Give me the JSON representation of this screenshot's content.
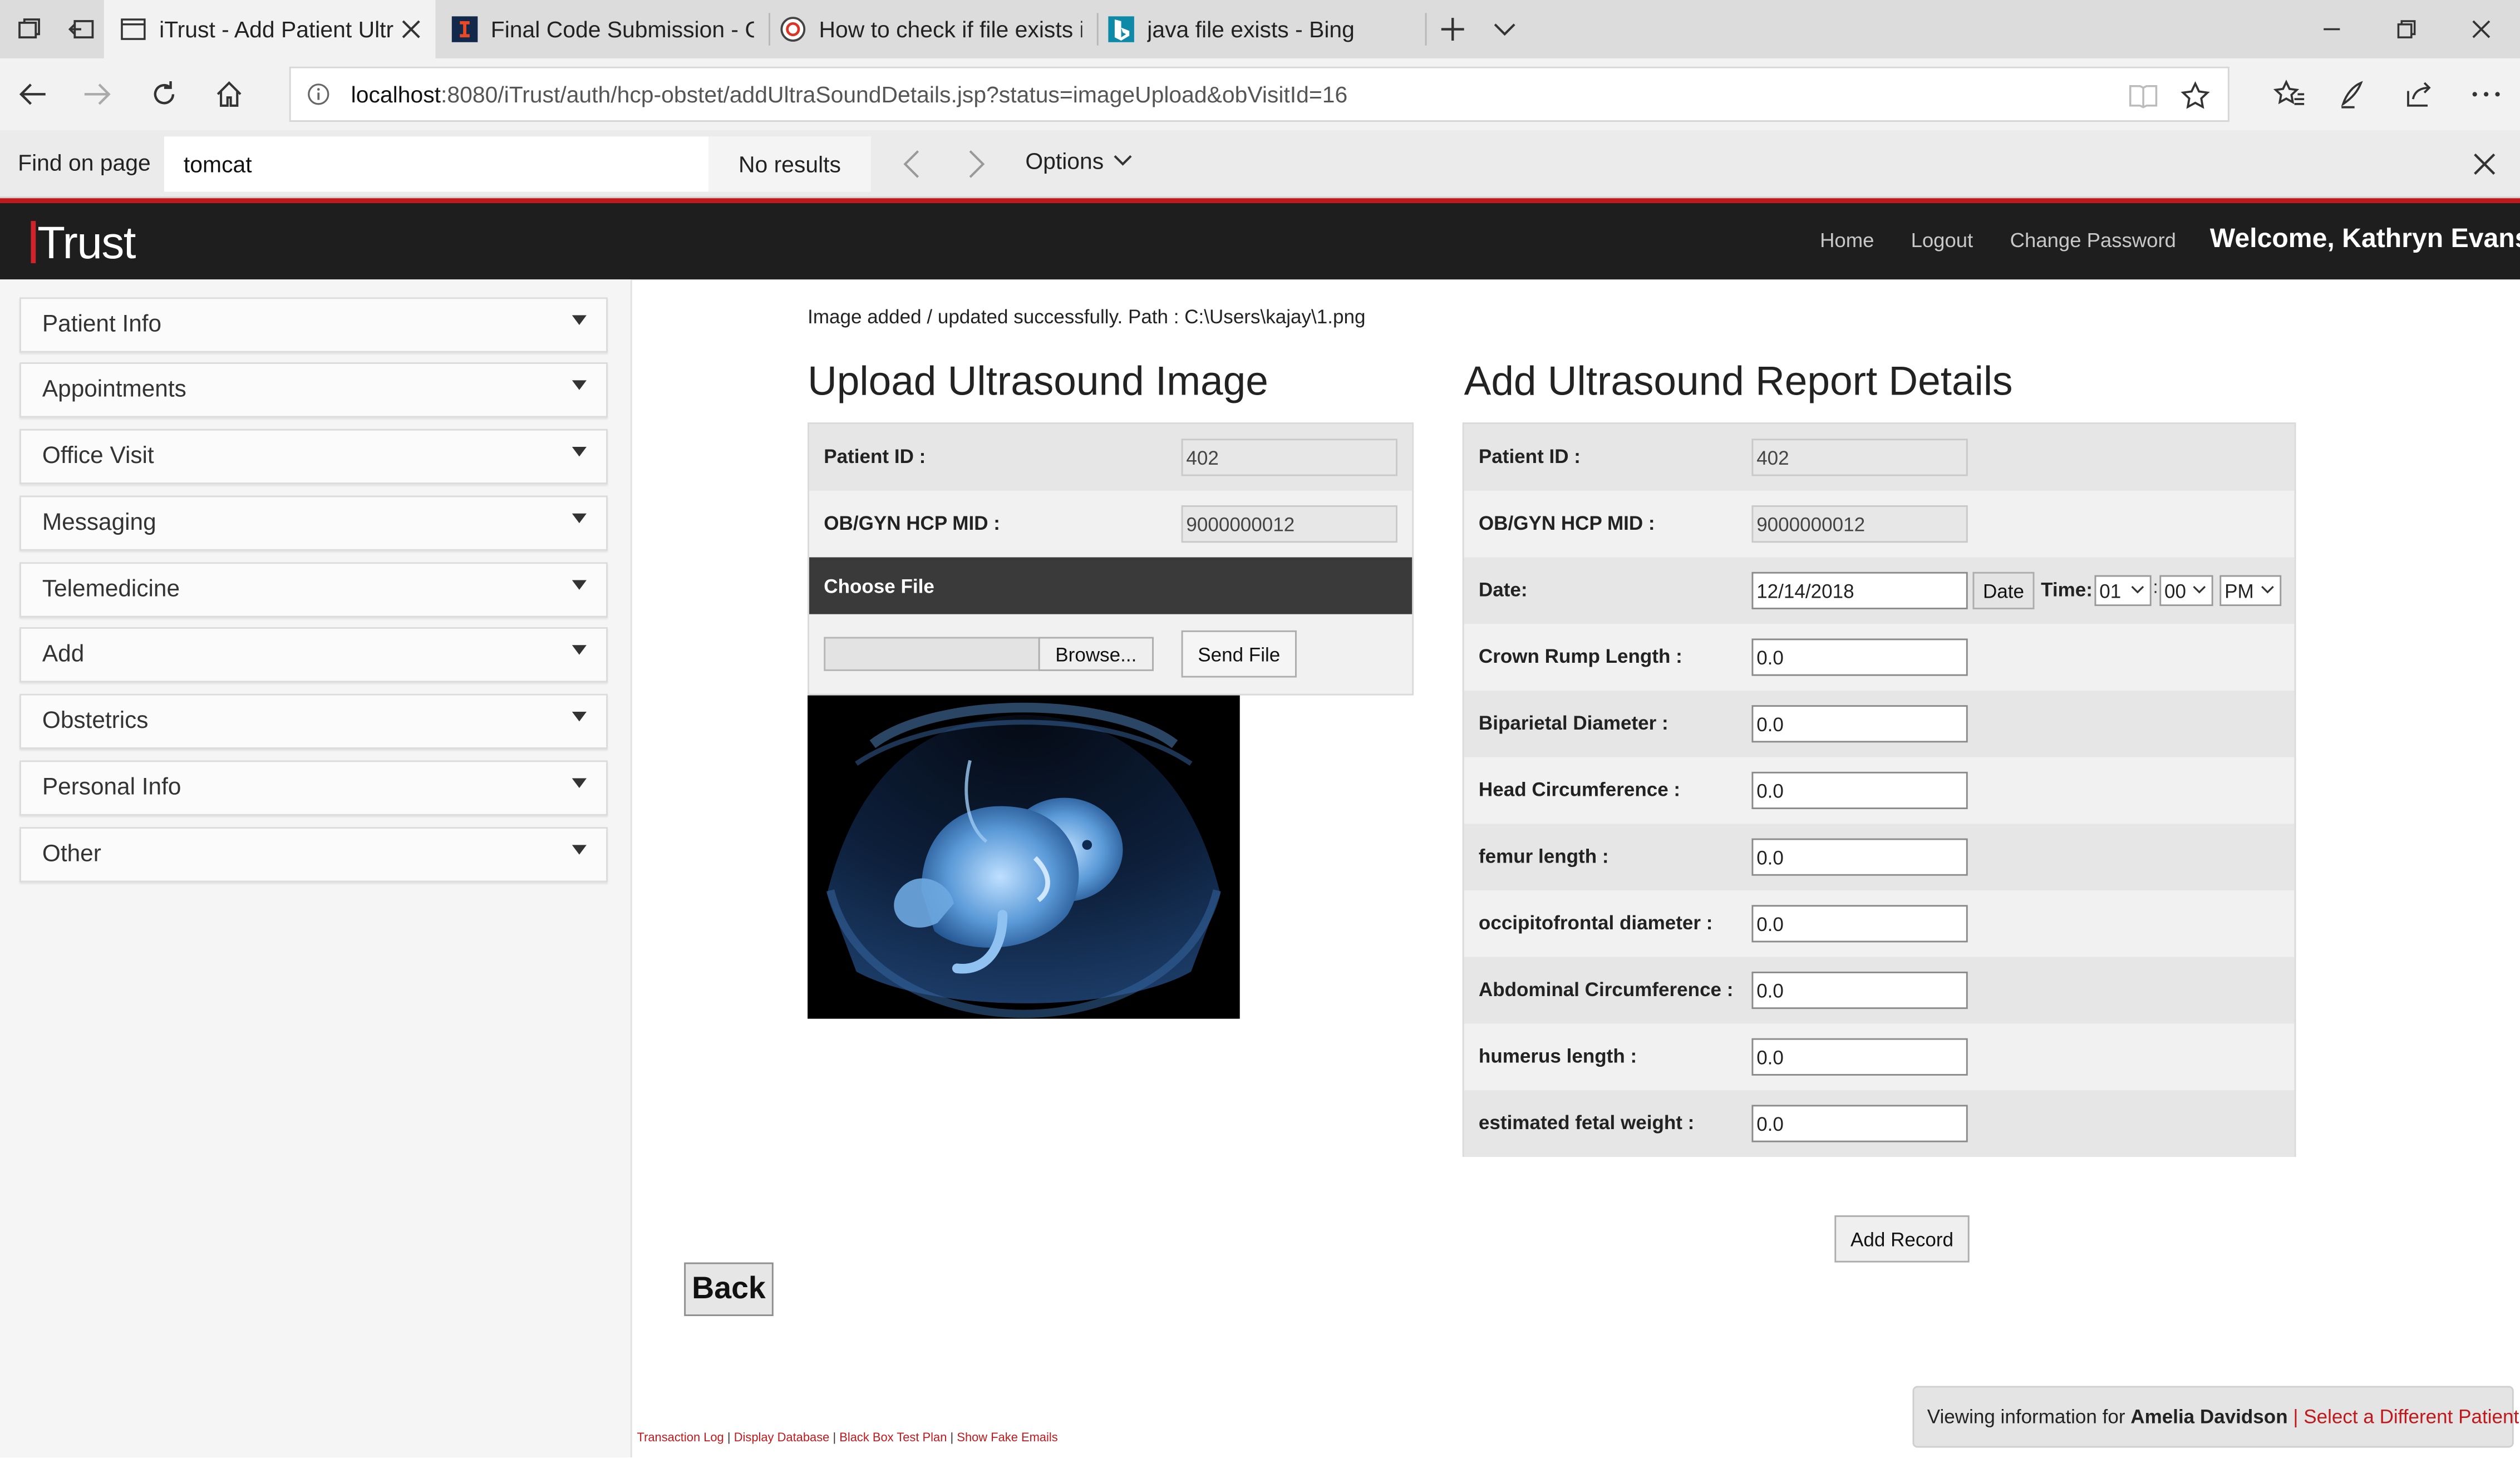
{
  "browser": {
    "tabs": [
      {
        "title": "iTrust - Add Patient Ultr",
        "active": true
      },
      {
        "title": "Final Code Submission - CS"
      },
      {
        "title": "How to check if file exists in"
      },
      {
        "title": "java file exists - Bing"
      }
    ],
    "url_host": "localhost",
    "url_rest": ":8080/iTrust/auth/hcp-obstet/addUltraSoundDetails.jsp?status=imageUpload&obVisitId=16"
  },
  "findbar": {
    "label": "Find on page",
    "query": "tomcat",
    "results": "No results",
    "options_label": "Options"
  },
  "app": {
    "logo": "Trust",
    "nav": {
      "home": "Home",
      "logout": "Logout",
      "change_password": "Change Password"
    },
    "welcome": "Welcome, Kathryn Evans",
    "accent_color": "#c0191c"
  },
  "sidebar": {
    "items": [
      "Patient Info",
      "Appointments",
      "Office Visit",
      "Messaging",
      "Telemedicine",
      "Add",
      "Obstetrics",
      "Personal Info",
      "Other"
    ]
  },
  "main": {
    "success_message": "Image added / updated successfully. Path : C:\\Users\\kajay\\1.png",
    "upload": {
      "heading": "Upload Ultrasound Image",
      "patient_id_label": "Patient ID :",
      "patient_id": "402",
      "hcp_mid_label": "OB/GYN HCP MID :",
      "hcp_mid": "9000000012",
      "choose_file": "Choose File",
      "browse": "Browse...",
      "send_file": "Send File"
    },
    "report": {
      "heading": "Add Ultrasound Report Details",
      "patient_id_label": "Patient ID :",
      "patient_id": "402",
      "hcp_mid_label": "OB/GYN HCP MID :",
      "hcp_mid": "9000000012",
      "date_label": "Date:",
      "date": "12/14/2018",
      "date_button": "Date",
      "time_label": "Time:",
      "hour": "01",
      "minute": "00",
      "ampm": "PM",
      "fields": [
        {
          "label": "Crown Rump Length :",
          "value": "0.0"
        },
        {
          "label": "Biparietal Diameter :",
          "value": "0.0"
        },
        {
          "label": "Head Circumference :",
          "value": "0.0"
        },
        {
          "label": "femur length :",
          "value": "0.0"
        },
        {
          "label": "occipitofrontal diameter :",
          "value": "0.0"
        },
        {
          "label": "Abdominal Circumference :",
          "value": "0.0"
        },
        {
          "label": "humerus length :",
          "value": "0.0"
        },
        {
          "label": "estimated fetal weight :",
          "value": "0.0"
        }
      ],
      "add_record": "Add Record"
    },
    "back": "Back"
  },
  "footer": {
    "links": [
      "Transaction Log",
      "Display Database",
      "Black Box Test Plan",
      "Show Fake Emails"
    ],
    "viewing_prefix": "Viewing information for",
    "patient_name": "Amelia Davidson",
    "select_different": "Select a Different Patient"
  }
}
